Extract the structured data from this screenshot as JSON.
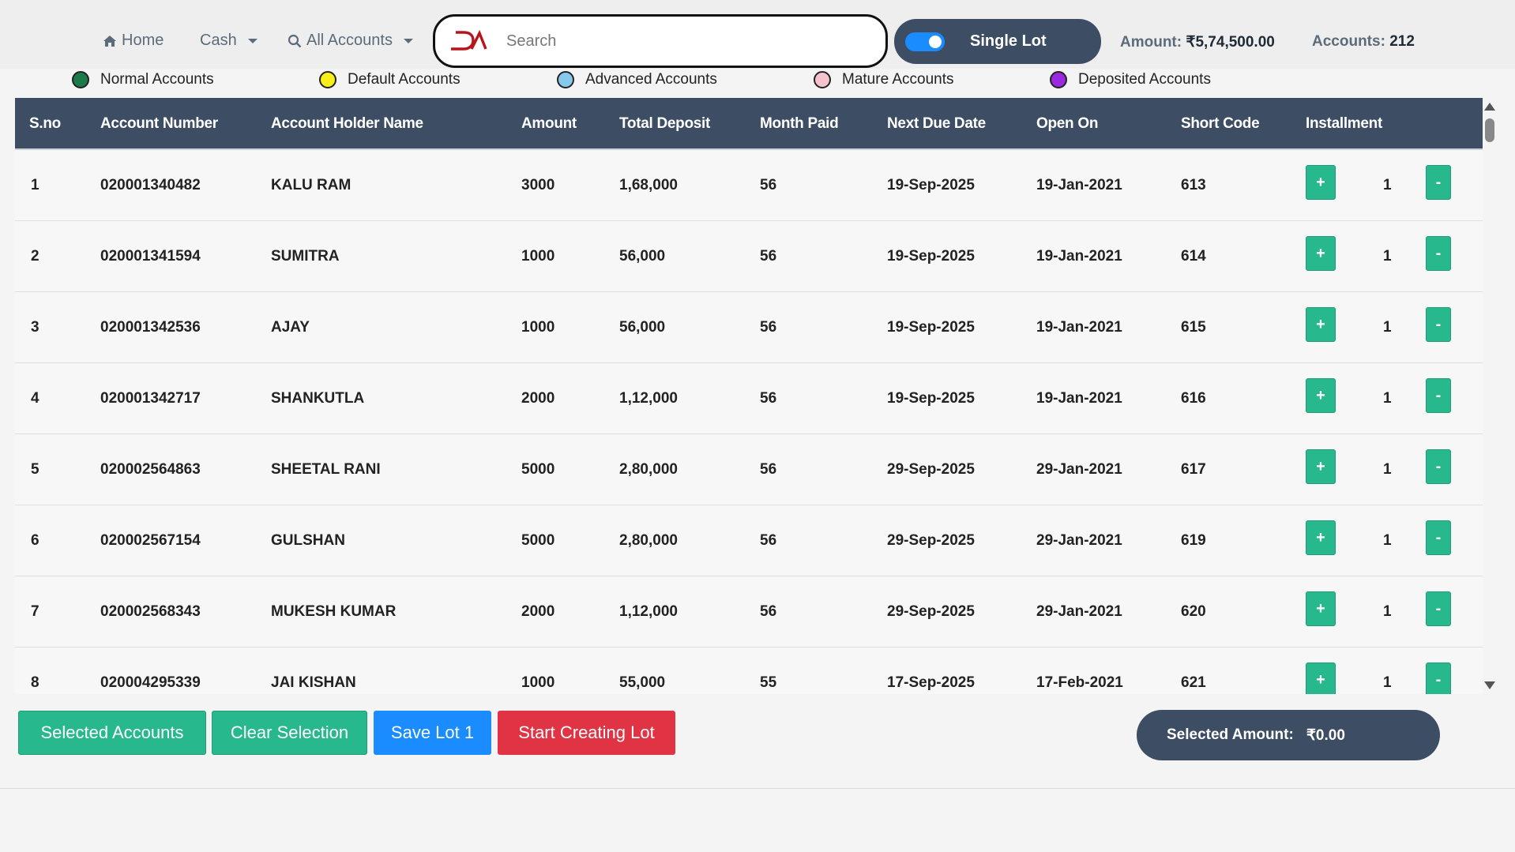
{
  "nav": {
    "home": "Home",
    "cash": "Cash",
    "all_accounts": "All Accounts"
  },
  "search": {
    "placeholder": "Search",
    "logo_text": "DA"
  },
  "lot_toggle": {
    "label": "Single Lot",
    "on": true
  },
  "stats": {
    "amount_label": "Amount:",
    "amount_value": "₹5,74,500.00",
    "accounts_label": "Accounts:",
    "accounts_value": "212"
  },
  "legend": [
    {
      "label": "Normal Accounts",
      "color": "#1a7a4a"
    },
    {
      "label": "Default Accounts",
      "color": "#f7ef1a"
    },
    {
      "label": "Advanced Accounts",
      "color": "#87c9ec"
    },
    {
      "label": "Mature Accounts",
      "color": "#f6c2cc"
    },
    {
      "label": "Deposited Accounts",
      "color": "#9a2ae0"
    }
  ],
  "table": {
    "headers": [
      "S.no",
      "Account Number",
      "Account Holder Name",
      "Amount",
      "Total Deposit",
      "Month Paid",
      "Next Due Date",
      "Open On",
      "Short Code",
      "Installment"
    ],
    "rows": [
      {
        "sno": "1",
        "account": "020001340482",
        "name": "KALU RAM",
        "amount": "3000",
        "deposit": "1,68,000",
        "month": "56",
        "due": "19-Sep-2025",
        "open": "19-Jan-2021",
        "code": "613",
        "inst": "1"
      },
      {
        "sno": "2",
        "account": "020001341594",
        "name": "SUMITRA",
        "amount": "1000",
        "deposit": "56,000",
        "month": "56",
        "due": "19-Sep-2025",
        "open": "19-Jan-2021",
        "code": "614",
        "inst": "1"
      },
      {
        "sno": "3",
        "account": "020001342536",
        "name": "AJAY",
        "amount": "1000",
        "deposit": "56,000",
        "month": "56",
        "due": "19-Sep-2025",
        "open": "19-Jan-2021",
        "code": "615",
        "inst": "1"
      },
      {
        "sno": "4",
        "account": "020001342717",
        "name": "SHANKUTLA",
        "amount": "2000",
        "deposit": "1,12,000",
        "month": "56",
        "due": "19-Sep-2025",
        "open": "19-Jan-2021",
        "code": "616",
        "inst": "1"
      },
      {
        "sno": "5",
        "account": "020002564863",
        "name": "SHEETAL RANI",
        "amount": "5000",
        "deposit": "2,80,000",
        "month": "56",
        "due": "29-Sep-2025",
        "open": "29-Jan-2021",
        "code": "617",
        "inst": "1"
      },
      {
        "sno": "6",
        "account": "020002567154",
        "name": "GULSHAN",
        "amount": "5000",
        "deposit": "2,80,000",
        "month": "56",
        "due": "29-Sep-2025",
        "open": "29-Jan-2021",
        "code": "619",
        "inst": "1"
      },
      {
        "sno": "7",
        "account": "020002568343",
        "name": "MUKESH KUMAR",
        "amount": "2000",
        "deposit": "1,12,000",
        "month": "56",
        "due": "29-Sep-2025",
        "open": "29-Jan-2021",
        "code": "620",
        "inst": "1"
      },
      {
        "sno": "8",
        "account": "020004295339",
        "name": "JAI KISHAN",
        "amount": "1000",
        "deposit": "55,000",
        "month": "55",
        "due": "17-Sep-2025",
        "open": "17-Feb-2021",
        "code": "621",
        "inst": "1"
      }
    ],
    "plus_label": "+",
    "minus_label": "-"
  },
  "actions": {
    "selected_accounts": "Selected Accounts",
    "clear_selection": "Clear Selection",
    "save_lot": "Save Lot 1",
    "start_creating_lot": "Start Creating Lot"
  },
  "selected_amount": {
    "label": "Selected Amount:",
    "value": "₹0.00"
  },
  "colors": {
    "header_bg": "#3d4d63",
    "accent_green": "#28b88e",
    "accent_blue": "#1a8cff",
    "accent_red": "#e03444",
    "logo_red": "#b8141c"
  }
}
